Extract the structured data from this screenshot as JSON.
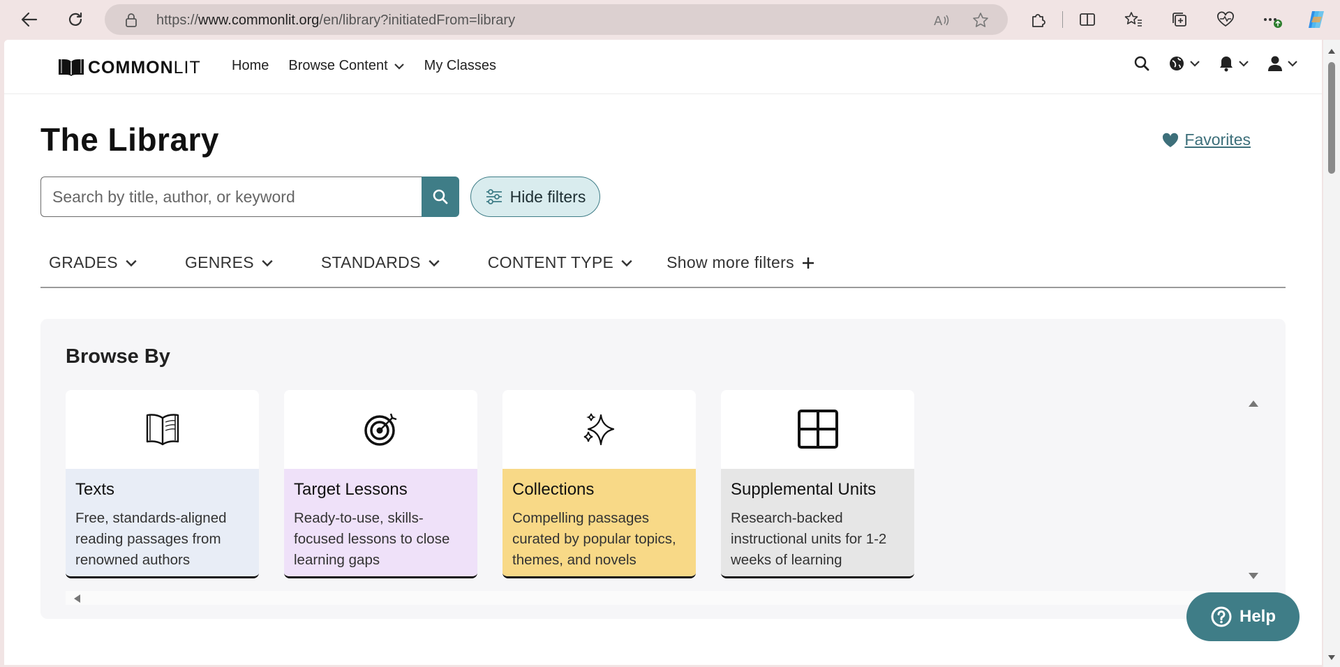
{
  "browser": {
    "url_prefix": "https://",
    "url_host": "www.commonlit.org",
    "url_path": "/en/library?initiatedFrom=library"
  },
  "site": {
    "logo_bold": "COMMON",
    "logo_light": "LIT",
    "nav": {
      "home": "Home",
      "browse": "Browse Content",
      "classes": "My Classes"
    }
  },
  "page": {
    "title": "The Library",
    "favorites": "Favorites",
    "search_placeholder": "Search by title, author, or keyword",
    "hide_filters": "Hide filters"
  },
  "filters": {
    "grades": "GRADES",
    "genres": "GENRES",
    "standards": "STANDARDS",
    "content_type": "CONTENT TYPE",
    "more": "Show more filters"
  },
  "browse": {
    "title": "Browse By",
    "cards": [
      {
        "title": "Texts",
        "desc": "Free, standards-aligned reading passages from renowned authors",
        "color": "#e8edf6",
        "icon": "open-book-icon"
      },
      {
        "title": "Target Lessons",
        "desc": "Ready-to-use, skills-focused lessons to close learning gaps",
        "color": "#efe1f9",
        "icon": "target-icon"
      },
      {
        "title": "Collections",
        "desc": "Compelling passages curated by popular topics, themes, and novels",
        "color": "#f8d987",
        "icon": "sparkles-icon"
      },
      {
        "title": "Supplemental Units",
        "desc": "Research-backed instructional units for 1-2 weeks of learning",
        "color": "#e6e6e6",
        "icon": "grid-icon"
      }
    ]
  },
  "help": {
    "label": "Help"
  },
  "colors": {
    "accent": "#3f7d87",
    "favorites": "#3d6f7a"
  }
}
